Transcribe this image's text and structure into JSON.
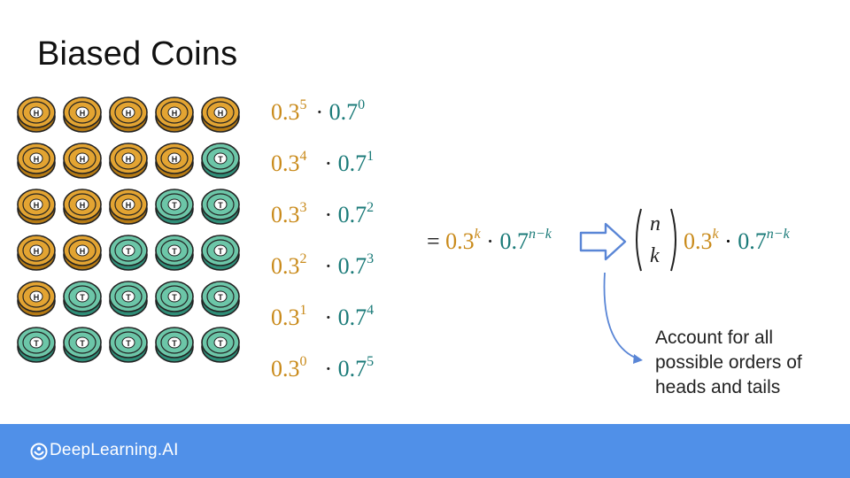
{
  "slide": {
    "title": "Biased Coins"
  },
  "coins": {
    "rows": [
      [
        "H",
        "H",
        "H",
        "H",
        "H"
      ],
      [
        "H",
        "H",
        "H",
        "H",
        "T"
      ],
      [
        "H",
        "H",
        "H",
        "T",
        "T"
      ],
      [
        "H",
        "H",
        "T",
        "T",
        "T"
      ],
      [
        "H",
        "T",
        "T",
        "T",
        "T"
      ],
      [
        "T",
        "T",
        "T",
        "T",
        "T"
      ]
    ],
    "colors": {
      "heads": "#e3a432",
      "tails": "#6cc6a8"
    }
  },
  "expressions": [
    {
      "base_h": "0.3",
      "exp_h": "5",
      "dot": "·",
      "base_t": "0.7",
      "exp_t": "0"
    },
    {
      "base_h": "0.3",
      "exp_h": "4",
      "dot": "·",
      "base_t": "0.7",
      "exp_t": "1"
    },
    {
      "base_h": "0.3",
      "exp_h": "3",
      "dot": "·",
      "base_t": "0.7",
      "exp_t": "2"
    },
    {
      "base_h": "0.3",
      "exp_h": "2",
      "dot": "·",
      "base_t": "0.7",
      "exp_t": "3"
    },
    {
      "base_h": "0.3",
      "exp_h": "1",
      "dot": "·",
      "base_t": "0.7",
      "exp_t": "4"
    },
    {
      "base_h": "0.3",
      "exp_h": "0",
      "dot": "·",
      "base_t": "0.7",
      "exp_t": "5"
    }
  ],
  "general": {
    "equals": "=",
    "base_h": "0.3",
    "exp_h": "k",
    "dot": "·",
    "base_t": "0.7",
    "exp_t": "n−k"
  },
  "binomial": {
    "top": "n",
    "bottom": "k"
  },
  "result": {
    "base_h": "0.3",
    "exp_h": "k",
    "dot": "·",
    "base_t": "0.7",
    "exp_t": "n−k"
  },
  "annotation": {
    "lines": [
      "Account for all",
      "possible orders of",
      "heads and tails"
    ]
  },
  "footer": {
    "brand": "DeepLearning.AI",
    "background": "#5090e8"
  },
  "accent_colors": {
    "heads_text": "#c98a1a",
    "tails_text": "#1a7a78"
  }
}
